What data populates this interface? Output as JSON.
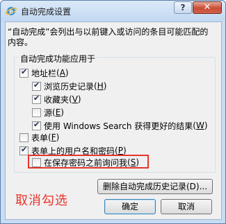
{
  "window": {
    "title": "自动完成设置",
    "help_label": "?",
    "close_label": "✕"
  },
  "description": "“自动完成”会列出与以前键入或访问的条目可能匹配的内容。",
  "group": {
    "label": "自动完成功能应用于",
    "items": [
      {
        "label": "地址栏",
        "hotkey": "A",
        "checked": true
      },
      {
        "label": "浏览历史记录",
        "hotkey": "H",
        "checked": true
      },
      {
        "label": "收藏夹",
        "hotkey": "V",
        "checked": true
      },
      {
        "label": "源",
        "hotkey": "E",
        "checked": false
      },
      {
        "label": "使用 Windows Search 获得更好的结果",
        "hotkey": "W",
        "checked": true
      },
      {
        "label": "表单",
        "hotkey": "F",
        "checked": false
      },
      {
        "label": "表单上的用户名和密码",
        "hotkey": "P",
        "checked": true
      },
      {
        "label": "在保存密码之前询问我",
        "hotkey": "S",
        "checked": false
      }
    ]
  },
  "annotation": "取消勾选",
  "buttons": {
    "delete_history": "删除自动完成历史记录(D)...",
    "ok": "确定",
    "cancel": "取消"
  }
}
